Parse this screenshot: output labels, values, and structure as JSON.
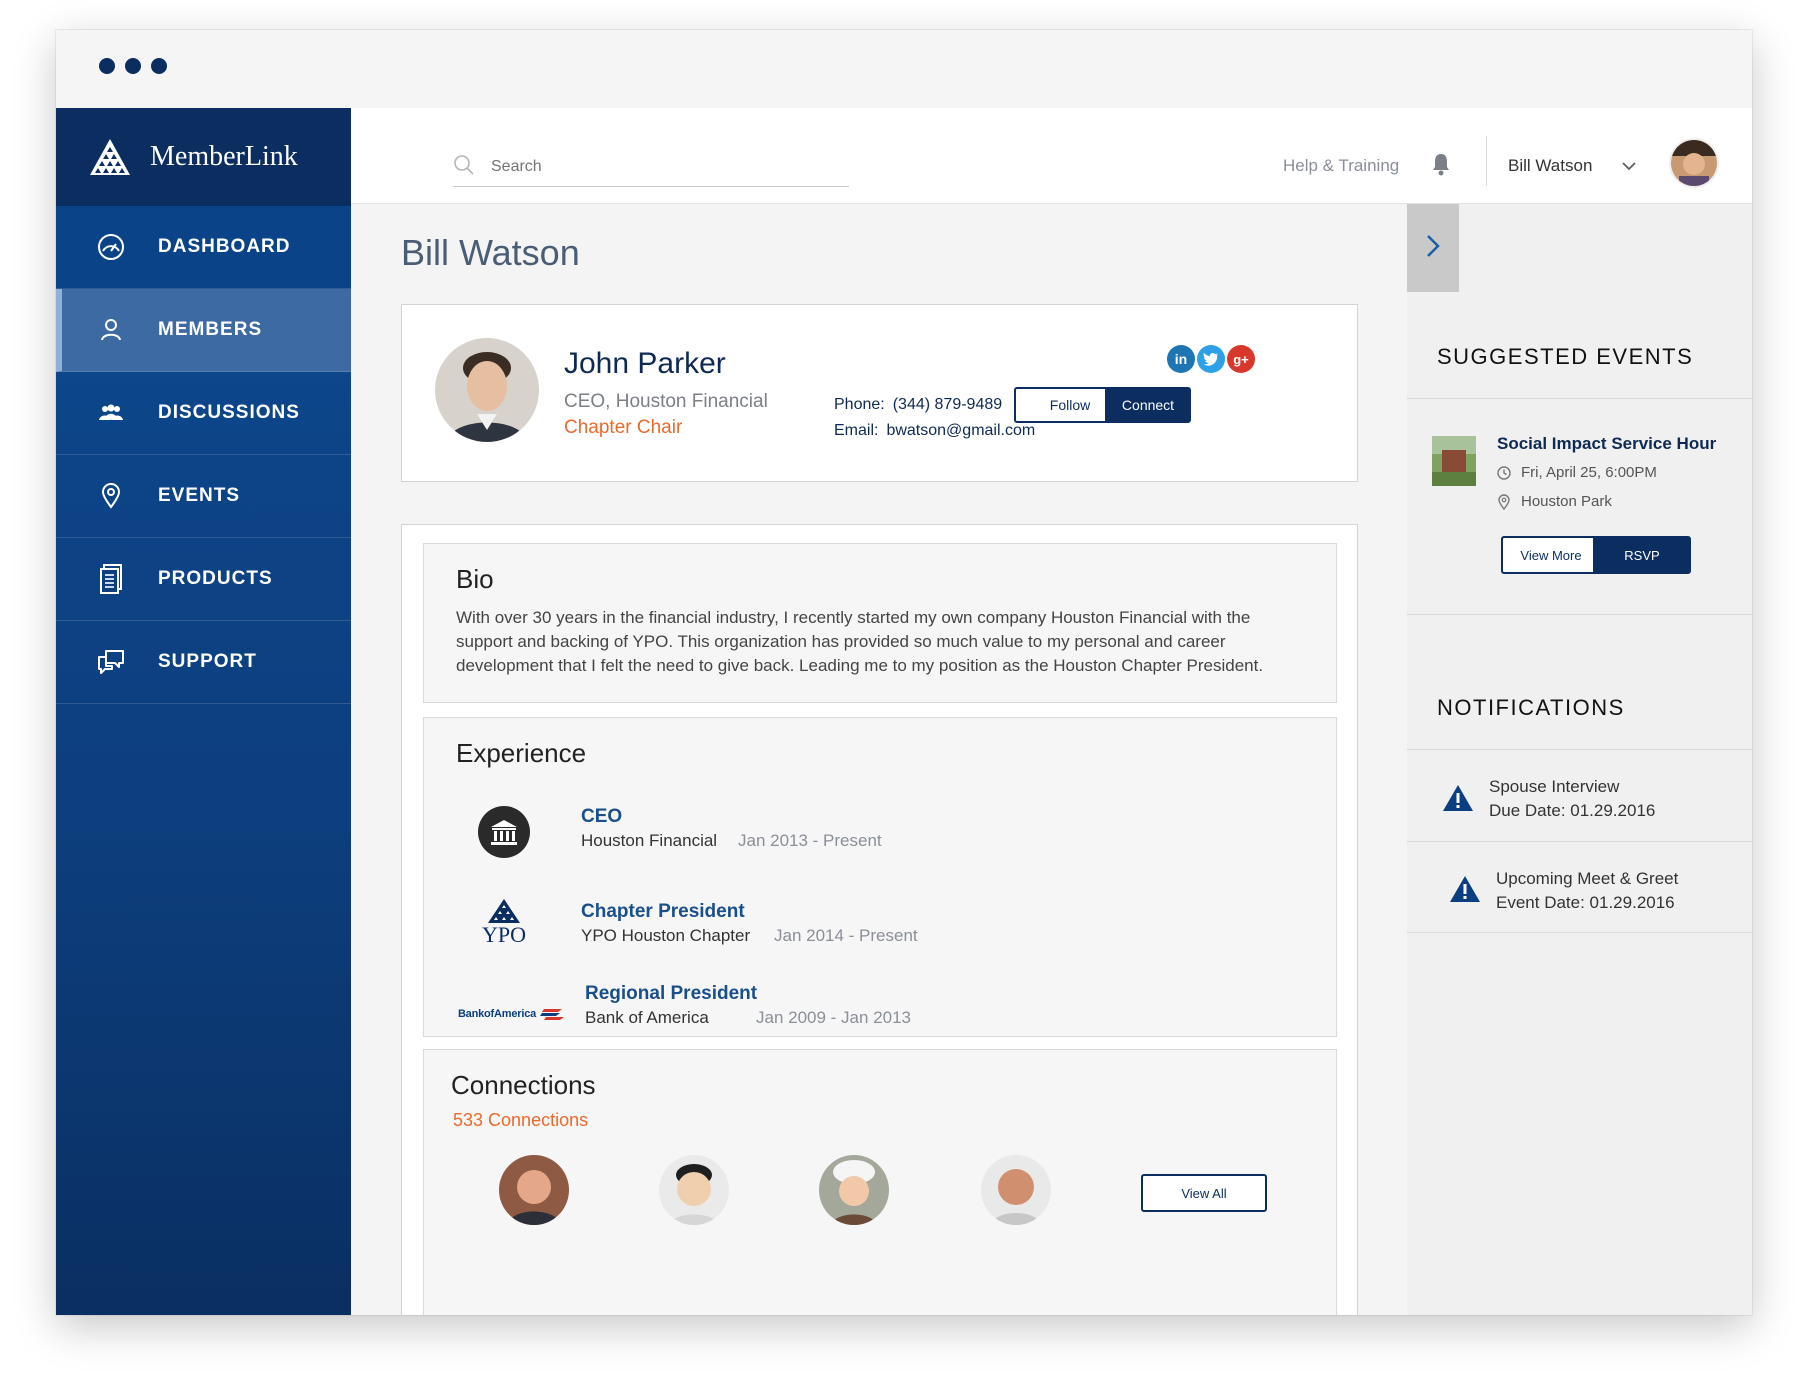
{
  "app": {
    "name": "MemberLink"
  },
  "sidebar": {
    "items": [
      {
        "label": "DASHBOARD",
        "icon": "dashboard-icon"
      },
      {
        "label": "MEMBERS",
        "icon": "person-icon"
      },
      {
        "label": "DISCUSSIONS",
        "icon": "group-icon"
      },
      {
        "label": "EVENTS",
        "icon": "location-pin-icon"
      },
      {
        "label": "PRODUCTS",
        "icon": "document-icon"
      },
      {
        "label": "SUPPORT",
        "icon": "chat-bubbles-icon"
      }
    ]
  },
  "topbar": {
    "search_placeholder": "Search",
    "help_label": "Help & Training",
    "user_name": "Bill Watson"
  },
  "page": {
    "title": "Bill Watson"
  },
  "profile": {
    "name": "John Parker",
    "title": "CEO, Houston Financial",
    "role": "Chapter Chair",
    "phone_label": "Phone:",
    "phone": "(344) 879-9489",
    "email_label": "Email:",
    "email": "bwatson@gmail.com",
    "follow_label": "Follow",
    "connect_label": "Connect",
    "socials": [
      "in",
      "t",
      "g+"
    ]
  },
  "bio": {
    "heading": "Bio",
    "text": "With over 30 years in the financial industry, I recently started my own company Houston Financial with the support and backing of YPO. This organization has provided so much value to my personal and career development that I felt the need to give back. Leading me to my position as the Houston Chapter President."
  },
  "experience": {
    "heading": "Experience",
    "items": [
      {
        "role": "CEO",
        "org": "Houston Financial",
        "dates": "Jan 2013 - Present"
      },
      {
        "role": "Chapter President",
        "org": "YPO Houston Chapter",
        "dates": "Jan 2014 - Present",
        "logo_text": "YPO"
      },
      {
        "role": "Regional President",
        "org": "Bank of America",
        "dates": "Jan 2009 - Jan 2013",
        "logo_text": "BankofAmerica"
      }
    ]
  },
  "connections": {
    "heading": "Connections",
    "count_label": "533 Connections",
    "view_all_label": "View All"
  },
  "rail": {
    "events_heading": "SUGGESTED EVENTS",
    "event": {
      "title": "Social Impact Service Hour",
      "datetime": "Fri, April 25, 6:00PM",
      "location": "Houston Park",
      "view_more_label": "View More",
      "rsvp_label": "RSVP"
    },
    "notifications_heading": "NOTIFICATIONS",
    "notifications": [
      {
        "title": "Spouse Interview",
        "date": "Due Date: 01.29.2016"
      },
      {
        "title": "Upcoming Meet & Greet",
        "date": "Event Date: 01.29.2016"
      }
    ]
  },
  "colors": {
    "navy": "#0b2d5f",
    "sidebar_blue": "#0d4a92",
    "active_item": "#3d6aa3",
    "accent_orange": "#e86a2c",
    "link_blue": "#1a4f8b"
  }
}
